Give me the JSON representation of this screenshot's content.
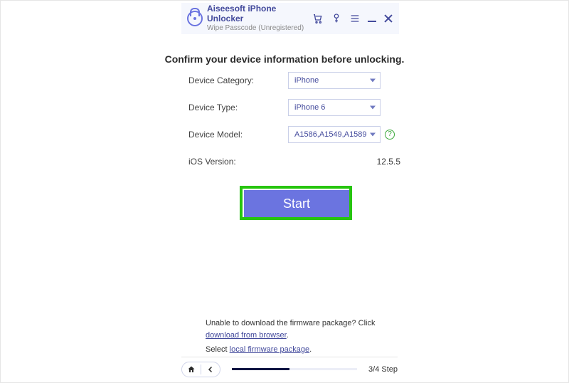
{
  "titlebar": {
    "title": "Aiseesoft iPhone Unlocker",
    "subtitle": "Wipe Passcode  (Unregistered)"
  },
  "heading": "Confirm your device information before unlocking.",
  "form": {
    "category_label": "Device Category:",
    "category_value": "iPhone",
    "type_label": "Device Type:",
    "type_value": "iPhone 6",
    "model_label": "Device Model:",
    "model_value": "A1586,A1549,A1589",
    "ios_label": "iOS Version:",
    "ios_value": "12.5.5"
  },
  "start_label": "Start",
  "hints": {
    "line1_pre": "Unable to download the firmware package? Click ",
    "line1_link": "download from browser",
    "line1_post": ".",
    "line2_pre": "Select ",
    "line2_link": "local firmware package",
    "line2_post": "."
  },
  "footer": {
    "step": "3/4 Step"
  },
  "icons": {
    "help": "?"
  }
}
